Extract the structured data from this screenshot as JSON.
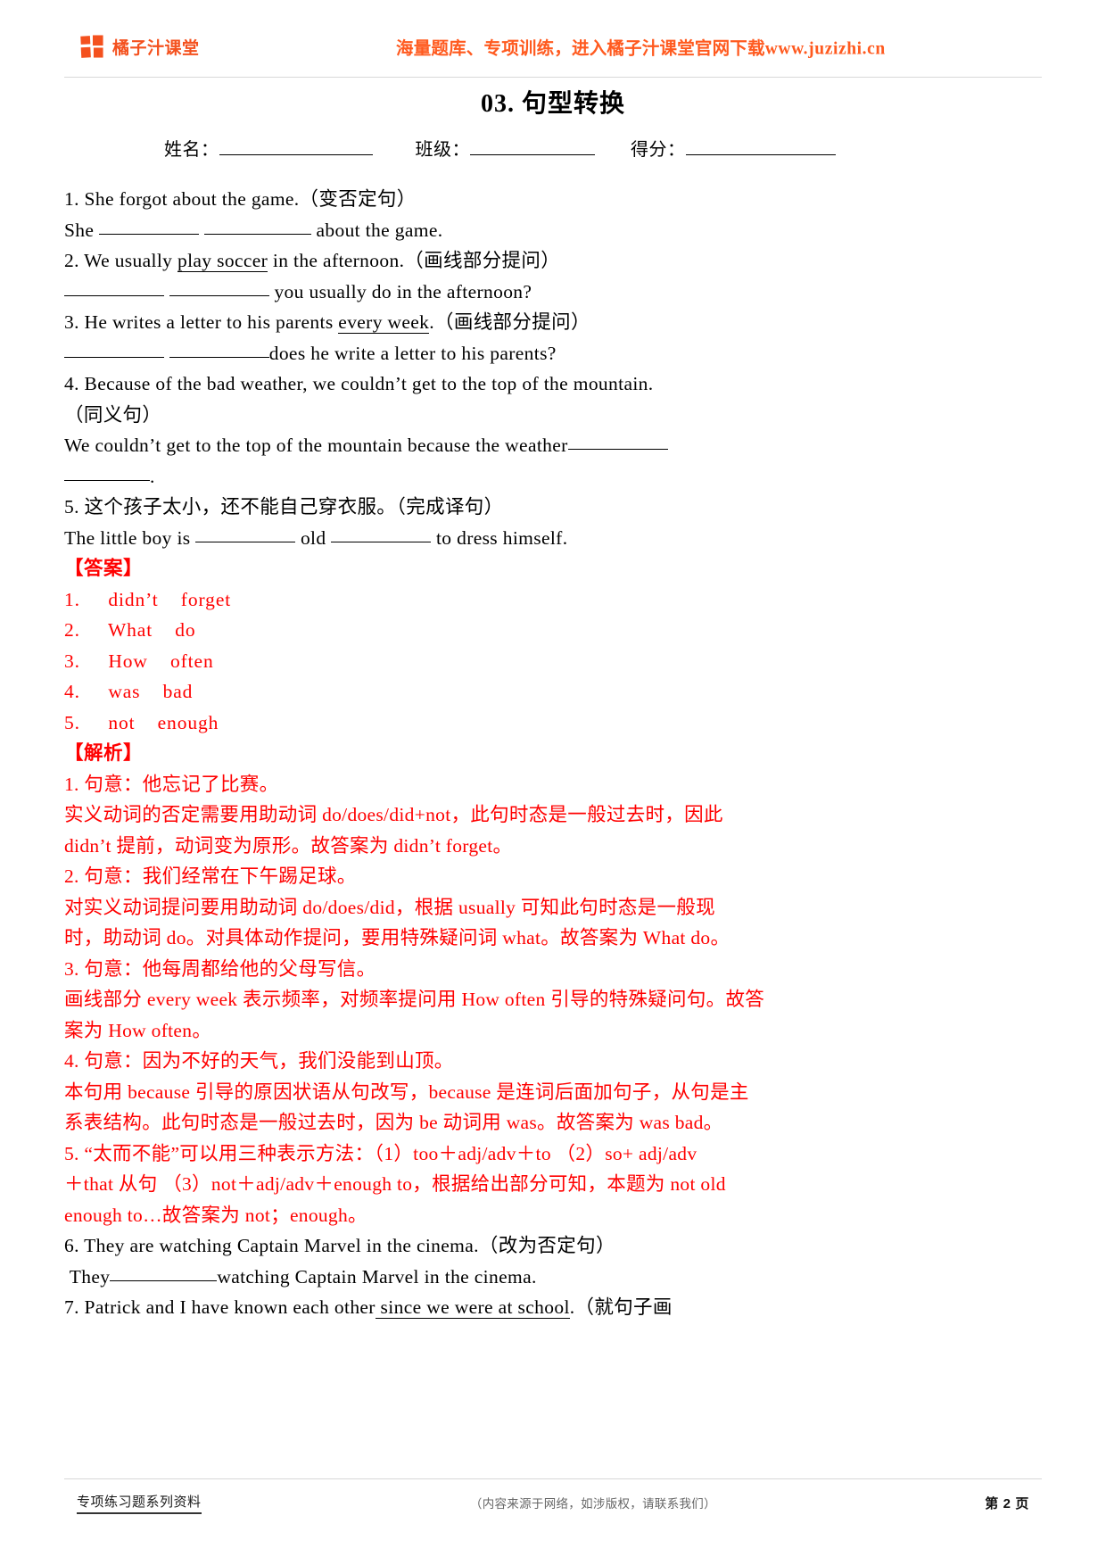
{
  "header": {
    "brand_name": "橘子汁课堂",
    "logo_icon": "four-square-logo-icon",
    "promo_text": "海量题库、专项训练，进入橘子汁课堂官网下载",
    "url": "www.juzizhi.cn",
    "brand_color": "#f4511e",
    "promo_color": "#ff5a1f"
  },
  "title": "03. 句型转换",
  "info": {
    "name_label": "姓名：",
    "class_label": "班级：",
    "score_label": "得分："
  },
  "questions": [
    {
      "q": "1. She forgot about the game.（变否定句）"
    },
    {
      "a_pre": "She ",
      "a_post": " about the game."
    },
    {
      "q2_pre": "2. We usually ",
      "q2_ul": "play soccer",
      "q2_post": " in the afternoon.（画线部分提问）"
    },
    {
      "a2_post": " you usually do in the afternoon?"
    },
    {
      "q3_pre": "3. He writes a letter to his parents ",
      "q3_ul": "every week",
      "q3_post": ".（画线部分提问）"
    },
    {
      "a3_post": "does he write a letter to his parents?"
    },
    {
      "q4": "4. Because of the bad weather, we couldn’t get to the top of the mountain."
    },
    {
      "q4b": "（同义句）"
    },
    {
      "a4_pre": "We couldn’t get to the top of the mountain because the weather"
    },
    {
      "a4_post": "."
    },
    {
      "q5": "5. 这个孩子太小，还不能自己穿衣服。（完成译句）"
    },
    {
      "a5_pre": "The little boy is ",
      "a5_mid": " old ",
      "a5_post": " to dress himself."
    }
  ],
  "answers": {
    "heading": "【答案】",
    "items": [
      {
        "num": "1.",
        "first": "didn’t",
        "second": "forget"
      },
      {
        "num": "2.",
        "first": "What",
        "second": "do"
      },
      {
        "num": "3.",
        "first": "How",
        "second": "often"
      },
      {
        "num": "4.",
        "first": "was",
        "second": "bad"
      },
      {
        "num": "5.",
        "first": "not",
        "second": "enough"
      }
    ]
  },
  "analysis": {
    "heading": "【解析】",
    "lines": [
      "1. 句意：他忘记了比赛。",
      "实义动词的否定需要用助动词 do/does/did+not，此句时态是一般过去时，因此",
      "didn’t 提前，动词变为原形。故答案为 didn’t forget。",
      "2. 句意：我们经常在下午踢足球。",
      "对实义动词提问要用助动词 do/does/did，根据 usually 可知此句时态是一般现",
      "时，助动词 do。对具体动作提问，要用特殊疑问词 what。故答案为 What do。",
      "3. 句意：他每周都给他的父母写信。",
      "画线部分 every week 表示频率，对频率提问用 How often 引导的特殊疑问句。故答",
      "案为 How often。",
      "4. 句意：因为不好的天气，我们没能到山顶。",
      "本句用 because 引导的原因状语从句改写，because 是连词后面加句子，从句是主",
      "系表结构。此句时态是一般过去时，因为 be 动词用 was。故答案为 was bad。",
      "5. “太而不能”可以用三种表示方法：（1）too＋adj/adv＋to （2）so+ adj/adv",
      "＋that 从句 （3）not＋adj/adv＋enough to，根据给出部分可知，本题为 not old",
      "enough to…故答案为 not；enough。"
    ]
  },
  "more_questions": {
    "q6": "6. They are watching Captain Marvel in the cinema.（改为否定句）",
    "a6_pre": " They",
    "a6_post": "watching Captain Marvel in the cinema.",
    "q7_pre": "7. Patrick and I have known each other",
    "q7_ul": " since we were at school",
    "q7_post": ".（就句子画"
  },
  "footer": {
    "left": "专项练习题系列资料",
    "center": "（内容来源于网络，如涉版权，请联系我们）",
    "right": "第 2 页"
  }
}
